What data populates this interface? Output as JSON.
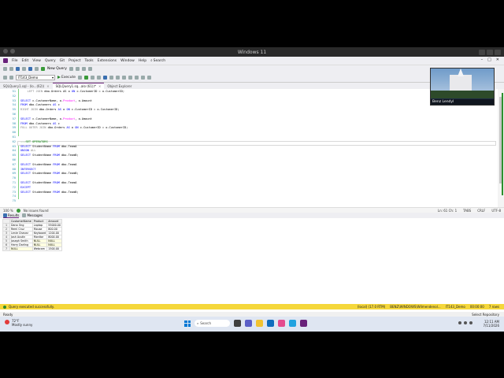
{
  "vm_title": "Windows 11",
  "menu": [
    "File",
    "Edit",
    "View",
    "Query",
    "Git",
    "Project",
    "Tools",
    "Extensions",
    "Window",
    "Help"
  ],
  "search_label": "Search",
  "toolbar": {
    "new_query": "New Query"
  },
  "toolbar2": {
    "database": "IT143_Demo",
    "execute": "Execute"
  },
  "tabs": [
    {
      "label": "SQLQuery1.sql - (lo...(62))",
      "active": false
    },
    {
      "label": "SQLQuery1.sq...alo (61))*",
      "active": true
    },
    {
      "label": "Object Explorer",
      "active": false
    }
  ],
  "editor": {
    "lines": [
      {
        "no": "51",
        "html": "    <span class='gr'>LEFT JOIN</span> dbo.Orders AS o <span class='kw'>ON</span> c.CustomerID = o.CustomerID;"
      },
      {
        "no": "52",
        "html": ""
      },
      {
        "no": "53",
        "html": "<span class='kw'>SELECT</span> c.CustomerName, o.<span class='mg'>Product</span>, o.Amount"
      },
      {
        "no": "54",
        "html": "<span class='kw'>FROM</span> dbo.Customers <span class='kw'>AS</span> c"
      },
      {
        "no": "55",
        "html": "<span class='gr'>RIGHT JOIN</span> dbo.Orders <span class='kw'>AS</span> o <span class='kw'>ON</span> c.CustomerID = o.CustomerID;"
      },
      {
        "no": "56",
        "html": ""
      },
      {
        "no": "57",
        "html": "<span class='kw'>SELECT</span> c.CustomerName, o.<span class='mg'>Product</span>, o.Amount"
      },
      {
        "no": "58",
        "html": "<span class='kw'>FROM</span> dbo.Customers <span class='kw'>AS</span> c"
      },
      {
        "no": "59",
        "html": "<span class='gr'>FULL OUTER JOIN</span> dbo.Orders <span class='kw'>AS</span> o <span class='kw'>ON</span> c.CustomerID = o.CustomerID;"
      },
      {
        "no": "60",
        "html": ""
      },
      {
        "no": "61",
        "html": ""
      },
      {
        "no": "62",
        "html": "<span class='cm'>---SET OPERATORS</span>"
      },
      {
        "no": "63",
        "html": "<span class='kw'>SELECT</span> StudentName <span class='kw'>FROM</span> dbo.TeamA"
      },
      {
        "no": "64",
        "html": "<span class='kw'>UNION</span> <span class='gr'>ALL</span>"
      },
      {
        "no": "65",
        "html": "<span class='kw'>SELECT</span> StudentName <span class='kw'>FROM</span> dbo.TeamB;"
      },
      {
        "no": "66",
        "html": ""
      },
      {
        "no": "67",
        "html": "<span class='kw'>SELECT</span> StudentName <span class='kw'>FROM</span> dbo.TeamA"
      },
      {
        "no": "68",
        "html": "<span class='kw'>INTERSECT</span>"
      },
      {
        "no": "69",
        "html": "<span class='kw'>SELECT</span> StudentName <span class='kw'>FROM</span> dbo.TeamB;"
      },
      {
        "no": "70",
        "html": ""
      },
      {
        "no": "71",
        "html": "<span class='kw'>SELECT</span> StudentName <span class='kw'>FROM</span> dbo.TeamA"
      },
      {
        "no": "72",
        "html": "<span class='kw'>EXCEPT</span>"
      },
      {
        "no": "73",
        "html": "<span class='kw'>SELECT</span> StudentName <span class='kw'>FROM</span> dbo.TeamB;"
      },
      {
        "no": "74",
        "html": ""
      },
      {
        "no": "75",
        "html": ""
      }
    ]
  },
  "status": {
    "zoom": "100 %",
    "issues": "No issues found",
    "position": "Ln: 61  Ch: 1",
    "tabs": "TABS",
    "eol": "CRLF",
    "encoding": "UTF-8"
  },
  "results_tabs": {
    "results": "Results",
    "messages": "Messages"
  },
  "results": {
    "columns": [
      "CustomerName",
      "Product",
      "Amount"
    ],
    "rows": [
      [
        "Dana Ong",
        "Laptop",
        "55000.00"
      ],
      [
        "Remi Cruz",
        "Mouse",
        "800.00"
      ],
      [
        "Lenie Chavez",
        "Keyboard",
        "1200.00"
      ],
      [
        "Josh Austin",
        "Monitor",
        "8000.00"
      ],
      [
        "Joseph Smith",
        "NULL",
        "NULL"
      ],
      [
        "Harry Darling",
        "NULL",
        "NULL"
      ],
      [
        "NULL",
        "Webcam",
        "1500.00"
      ]
    ]
  },
  "query_status": {
    "message": "Query executed successfully.",
    "server": "(local) (17.0 RTM)",
    "login": "BENZ\\WINDOWS\\Wilmendenol...",
    "db": "IT143_Demo",
    "time": "00:00:00",
    "rows": "7 rows"
  },
  "ready": "Ready",
  "ready_right": "Select Repository",
  "weather": {
    "temp": "72°F",
    "desc": "Mostly sunny"
  },
  "taskbar_search": "Search",
  "clock": {
    "time": "12:11 AM",
    "date": "7/11/2026"
  },
  "webcam_name": "Benz Lendyl"
}
